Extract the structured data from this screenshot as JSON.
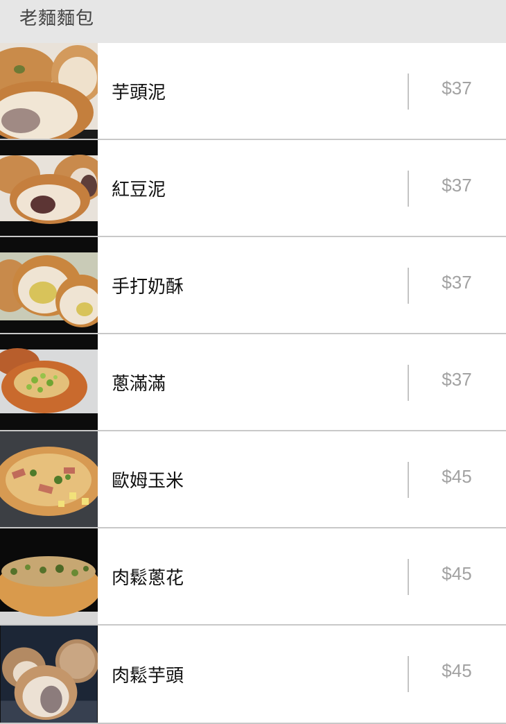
{
  "header": {
    "title": "老麵麵包"
  },
  "items": [
    {
      "name": "芋頭泥",
      "price": "$37",
      "image": "taro-bun-photo"
    },
    {
      "name": "紅豆泥",
      "price": "$37",
      "image": "red-bean-bun-photo"
    },
    {
      "name": "手打奶酥",
      "price": "$37",
      "image": "custard-bun-photo"
    },
    {
      "name": "蔥滿滿",
      "price": "$37",
      "image": "scallion-bun-photo"
    },
    {
      "name": "歐姆玉米",
      "price": "$45",
      "image": "corn-ham-bun-photo"
    },
    {
      "name": "肉鬆蔥花",
      "price": "$45",
      "image": "pork-floss-scallion-bun-photo"
    },
    {
      "name": "肉鬆芋頭",
      "price": "$45",
      "image": "pork-floss-taro-bun-photo"
    }
  ]
}
